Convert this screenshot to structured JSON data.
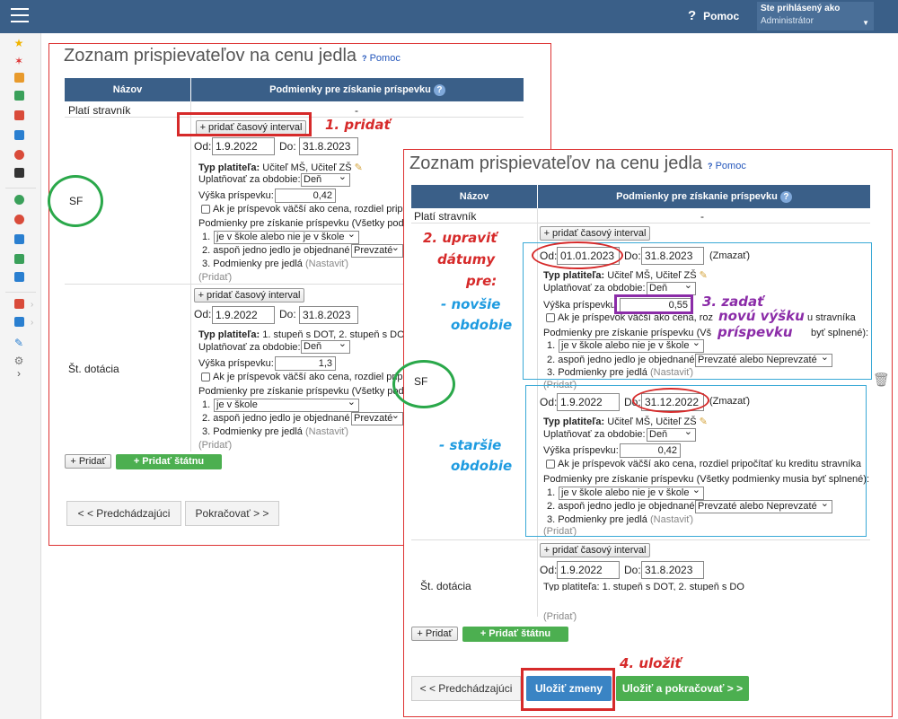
{
  "header": {
    "help_label": "Pomoc",
    "logged_in_label": "Ste prihlásený ako",
    "user_role": "Administrátor"
  },
  "sidebar": {
    "icons": [
      "star-icon",
      "magic-icon",
      "mail-icon",
      "home-icon",
      "calendar-icon",
      "book-icon",
      "user-icon",
      "calendar-alt-icon",
      "check-circle-icon",
      "no-icon",
      "briefcase-icon",
      "shield-icon",
      "chart-icon",
      "users-icon",
      "box-icon",
      "pencil-icon",
      "gear-icon"
    ]
  },
  "back_panel": {
    "title": "Zoznam prispievateľov na cenu jedla",
    "help": "Pomoc",
    "col_name": "Názov",
    "col_conditions": "Podmienky pre získanie príspevku",
    "row_plati": "Platí stravník",
    "row_plati_dash": "-",
    "sf": {
      "name": "SF",
      "add_interval": "+ pridať časový interval",
      "od_label": "Od:",
      "od_value": "1.9.2022",
      "do_label": "Do:",
      "do_value": "31.8.2023",
      "typ_label": "Typ platiteľa:",
      "typ_value": "Učiteľ MŠ, Učiteľ ZŠ",
      "uplat_label": "Uplatňovať za obdobie:",
      "uplat_value": "Deň",
      "vyska_label": "Výška príspevku:",
      "vyska_value": "0,42",
      "checkbox_label": "Ak je príspevok väčší ako cena, rozdiel pripoč",
      "cond_label": "Podmienky pre získanie príspevku (Všetky podm",
      "cond1_num": "1.",
      "cond1": "je v škole alebo nie je v škole",
      "cond2": "2. aspoň jedno jedlo je objednané",
      "cond2_sel": "Prevzaté al",
      "cond3": "3. Podmienky pre jedlá",
      "nastavit": "(Nastaviť)",
      "pridat": "(Pridať)"
    },
    "st": {
      "name": "Št. dotácia",
      "add_interval": "+ pridať časový interval",
      "od_label": "Od:",
      "od_value": "1.9.2022",
      "do_label": "Do:",
      "do_value": "31.8.2023",
      "typ_label": "Typ platiteľa:",
      "typ_value": "1. stupeň s DOT, 2. stupeň s DOT",
      "uplat_label": "Uplatňovať za obdobie:",
      "uplat_value": "Deň",
      "vyska_label": "Výška príspevku:",
      "vyska_value": "1,3",
      "checkbox_label": "Ak je príspevok väčší ako cena, rozdiel pripoč",
      "cond_label": "Podmienky pre získanie príspevku (Všetky podm",
      "cond1_num": "1.",
      "cond1": "je v škole",
      "cond2": "2. aspoň jedno jedlo je objednané",
      "cond2_sel": "Prevzaté",
      "cond3": "3. Podmienky pre jedlá",
      "nastavit": "(Nastaviť)",
      "pridat": "(Pridať)"
    },
    "add": "+ Pridať",
    "add_state": "+ Pridať štátnu dotáciu",
    "prev": "< < Predchádzajúci",
    "next": "Pokračovať > >"
  },
  "front_panel": {
    "title": "Zoznam prispievateľov na cenu jedla",
    "help": "Pomoc",
    "col_name": "Názov",
    "col_conditions": "Podmienky pre získanie príspevku",
    "row_plati": "Platí stravník",
    "row_plati_dash": "-",
    "sf_name": "SF",
    "add_interval": "+ pridať časový interval",
    "new": {
      "od_label": "Od:",
      "od_value": "01.01.2023",
      "do_label": "Do:",
      "do_value": "31.8.2023",
      "zmazat": "(Zmazať)",
      "typ_label": "Typ platiteľa:",
      "typ_value": "Učiteľ MŠ, Učiteľ ZŠ",
      "uplat_label": "Uplatňovať za obdobie:",
      "uplat_value": "Deň",
      "vyska_label": "Výška príspevku",
      "vyska_value": "0,55",
      "checkbox_label": "Ak je príspevok väčší ako cena, roz",
      "checkbox_tail": "u stravníka",
      "cond_label": "Podmienky pre získanie príspevku (Vš",
      "cond_tail": "byť splnené):",
      "cond1_num": "1.",
      "cond1": "je v škole alebo nie je v škole",
      "cond2": "2. aspoň jedno jedlo je objednané",
      "cond2_sel": "Prevzaté alebo Neprevzaté",
      "cond3": "3. Podmienky pre jedlá",
      "nastavit": "(Nastaviť)",
      "pridat": "(Pridať)"
    },
    "old": {
      "od_label": "Od:",
      "od_value": "1.9.2022",
      "do_label": "Do:",
      "do_value": "31.12.2022",
      "zmazat": "(Zmazať)",
      "typ_label": "Typ platiteľa:",
      "typ_value": "Učiteľ MŠ, Učiteľ ZŠ",
      "uplat_label": "Uplatňovať za obdobie:",
      "uplat_value": "Deň",
      "vyska_label": "Výška príspevku:",
      "vyska_value": "0,42",
      "checkbox_label": "Ak je príspevok väčší ako cena, rozdiel pripočítať ku kreditu stravníka",
      "cond_label": "Podmienky pre získanie príspevku (Všetky podmienky musia byť splnené):",
      "cond1_num": "1.",
      "cond1": "je v škole alebo nie je v škole",
      "cond2": "2. aspoň jedno jedlo je objednané",
      "cond2_sel": "Prevzaté alebo Neprevzaté",
      "cond3": "3. Podmienky pre jedlá",
      "nastavit": "(Nastaviť)",
      "pridat": "(Pridať)"
    },
    "st": {
      "name": "Št. dotácia",
      "add_interval": "+ pridať časový interval",
      "od_label": "Od:",
      "od_value": "1.9.2022",
      "do_label": "Do:",
      "do_value": "31.8.2023",
      "typ_partial": "Typ platiteľa: 1. stupeň s DOT, 2. stupeň s DO",
      "pridat": "(Pridať)"
    },
    "add": "+ Pridať",
    "add_state": "+ Pridať štátnu dotáciu",
    "prev": "< < Predchádzajúci",
    "save": "Uložiť zmeny",
    "save_continue": "Uložiť a pokračovať > >"
  },
  "annotations": {
    "step1": "1.  pridať",
    "step2_l1": "2.  upraviť",
    "step2_l2": "dátumy",
    "step2_l3": "pre:",
    "newer_l1": "- novšie",
    "newer_l2": "obdobie",
    "step3_l1": "3.  zadať",
    "step3_l2": "novú výšku",
    "step3_l3": "príspevku",
    "older_l1": "- staršie",
    "older_l2": "obdobie",
    "step4": "4. uložiť"
  },
  "colors": {
    "header_bg": "#3a5f88",
    "annotation_red": "#d62a2a",
    "annotation_blue": "#1e9be0",
    "annotation_purple": "#8b2ca8",
    "annotation_green": "#2aa84a",
    "save_button": "#3a84c4",
    "green_button": "#4caf50"
  }
}
